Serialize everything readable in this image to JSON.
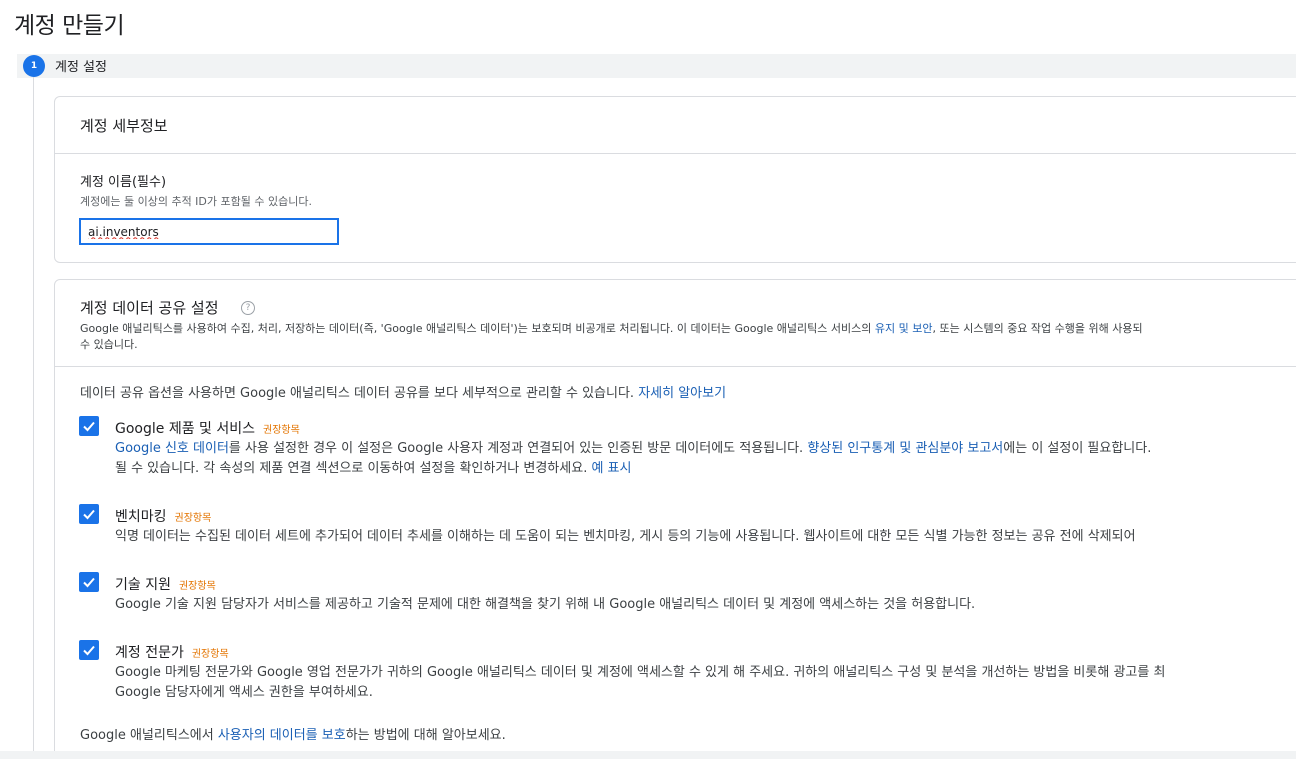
{
  "page": {
    "title": "계정 만들기"
  },
  "step": {
    "number": "1",
    "label": "계정 설정"
  },
  "account_details": {
    "title": "계정 세부정보",
    "name_label": "계정 이름(필수)",
    "name_help": "계정에는 둘 이상의 추적 ID가 포함될 수 있습니다.",
    "name_value": "ai.inventors"
  },
  "sharing": {
    "title": "계정 데이터 공유 설정",
    "help_icon": "question-icon",
    "desc_line1_prefix": "Google 애널리틱스를 사용하여 수집, 처리, 저장하는 데이터(즉, 'Google 애널리틱스 데이터')는 보호되며 비공개로 처리됩니다. 이 데이터는 Google 애널리틱스 서비스의 ",
    "desc_link1": "유지 및 보안",
    "desc_line1_suffix": ", 또는 시스템의 중요 작업 수행을 위해 사용되",
    "desc_line2": "수 있습니다.",
    "intro_text": "데이터 공유 옵션을 사용하면 Google 애널리틱스 데이터 공유를 보다 세부적으로 관리할 수 있습니다. ",
    "intro_link": "자세히 알아보기",
    "badge": "권장항목",
    "options": [
      {
        "title": "Google 제품 및 서비스",
        "line1_link1": "Google 신호 데이터",
        "line1_mid": "를 사용 설정한 경우 이 설정은 Google 사용자 계정과 연결되어 있는 인증된 방문 데이터에도 적용됩니다. ",
        "line1_link2": "향상된 인구통계 및 관심분야 보고서",
        "line1_suffix": "에는 이 설정이 필요합니다.",
        "line2": "될 수 있습니다. 각 속성의 제품 연결 섹션으로 이동하여 설정을 확인하거나 변경하세요. ",
        "line2_link": "예 표시"
      },
      {
        "title": "벤치마킹",
        "line1": "익명 데이터는 수집된 데이터 세트에 추가되어 데이터 추세를 이해하는 데 도움이 되는 벤치마킹, 게시 등의 기능에 사용됩니다. 웹사이트에 대한 모든 식별 가능한 정보는 공유 전에 삭제되어"
      },
      {
        "title": "기술 지원",
        "line1": "Google 기술 지원 담당자가 서비스를 제공하고 기술적 문제에 대한 해결책을 찾기 위해 내 Google 애널리틱스 데이터 및 계정에 액세스하는 것을 허용합니다."
      },
      {
        "title": "계정 전문가",
        "line1": "Google 마케팅 전문가와 Google 영업 전문가가 귀하의 Google 애널리틱스 데이터 및 계정에 액세스할 수 있게 해 주세요. 귀하의 애널리틱스 구성 및 분석을 개선하는 방법을 비롯해 광고를 최",
        "line2": "Google 담당자에게 액세스 권한을 부여하세요."
      }
    ],
    "footer_prefix": "Google 애널리틱스에서 ",
    "footer_link": "사용자의 데이터를 보호",
    "footer_suffix": "하는 방법에 대해 알아보세요."
  },
  "colors": {
    "accent": "#1a73e8",
    "badge": "#e37400",
    "link": "#1a5fb4"
  }
}
